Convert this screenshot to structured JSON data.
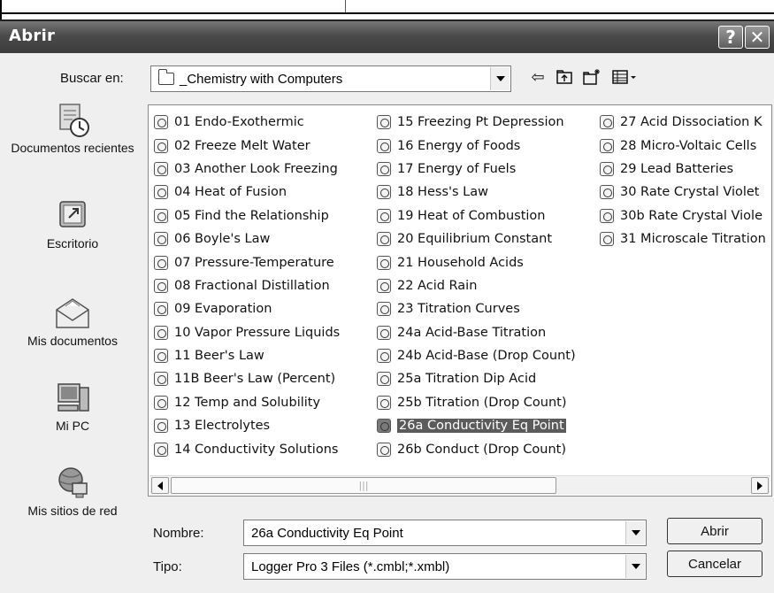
{
  "dialog": {
    "title": "Abrir"
  },
  "lookin": {
    "label": "Buscar en:",
    "value": "_Chemistry with Computers"
  },
  "toolbar": {
    "icons": [
      "back-icon",
      "up-folder-icon",
      "new-folder-icon",
      "view-menu-icon"
    ]
  },
  "places": [
    {
      "label": "Documentos recientes",
      "icon": "recent-documents-icon"
    },
    {
      "label": "Escritorio",
      "icon": "desktop-icon"
    },
    {
      "label": "Mis documentos",
      "icon": "my-documents-icon"
    },
    {
      "label": "Mi PC",
      "icon": "my-computer-icon"
    },
    {
      "label": "Mis sitios de red",
      "icon": "network-places-icon"
    }
  ],
  "files": {
    "col1": [
      "01 Endo-Exothermic",
      "02 Freeze Melt Water",
      "03 Another Look Freezing",
      "04 Heat of Fusion",
      "05 Find the Relationship",
      "06 Boyle's Law",
      "07 Pressure-Temperature",
      "08 Fractional Distillation",
      "09 Evaporation",
      "10 Vapor Pressure Liquids",
      "11 Beer's Law",
      "11B Beer's Law (Percent)",
      "12 Temp and Solubility",
      "13 Electrolytes",
      "14 Conductivity Solutions"
    ],
    "col2": [
      "15 Freezing Pt Depression",
      "16 Energy of Foods",
      "17 Energy of Fuels",
      "18 Hess's Law",
      "19 Heat of Combustion",
      "20 Equilibrium Constant",
      "21 Household Acids",
      "22 Acid Rain",
      "23 Titration Curves",
      "24a Acid-Base Titration",
      "24b Acid-Base (Drop Count)",
      "25a Titration Dip Acid",
      "25b Titration (Drop Count)",
      "26a Conductivity Eq Point",
      "26b Conduct (Drop Count)"
    ],
    "col3": [
      "27 Acid Dissociation K",
      "28 Micro-Voltaic Cells",
      "29 Lead Batteries",
      "30 Rate Crystal Violet",
      "30b Rate Crystal Viole",
      "31 Microscale Titration"
    ],
    "selected": "26a Conductivity Eq Point"
  },
  "filename": {
    "label": "Nombre:",
    "value": "26a Conductivity Eq Point"
  },
  "filetype": {
    "label": "Tipo:",
    "value": "Logger Pro 3 Files (*.cmbl;*.xmbl)"
  },
  "buttons": {
    "open": "Abrir",
    "cancel": "Cancelar"
  }
}
